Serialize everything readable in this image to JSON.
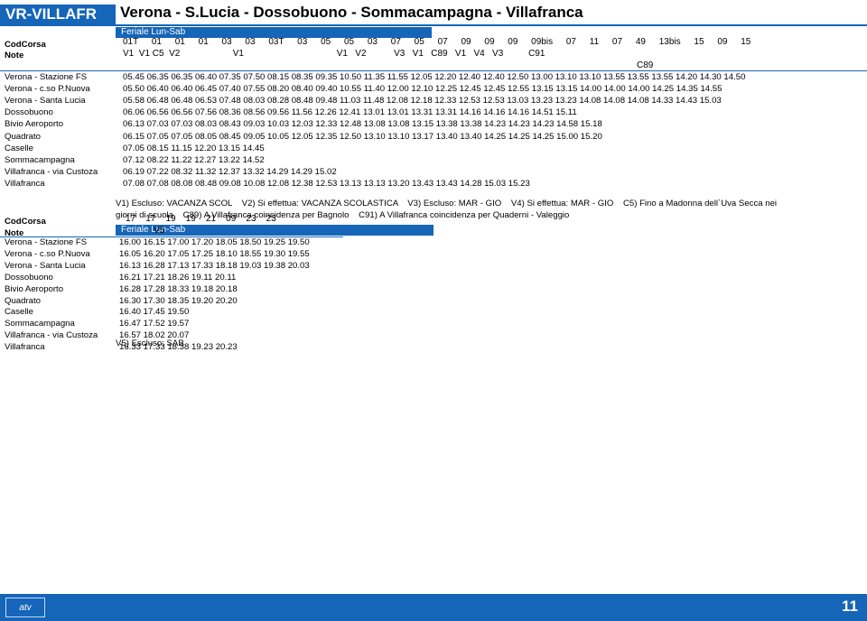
{
  "header": {
    "tag": "VR-VILLAFR",
    "title": "Verona - S.Lucia - Dossobuono - Sommacampagna - Villafranca"
  },
  "table1": {
    "band_label": "Feriale Lun-Sab",
    "codcorsa_label": "CodCorsa",
    "codcorsa": "01T 01 01 01 03 03 03T 03 05 05 03 07 05 07 09 09 09 09bis 07 11 07 49 13bis 15 09 15",
    "note_label": "Note",
    "note": "V1  V1 C5  V2                     V1                                     V1   V2           V3   V1   C89   V1   V4   V3          C91",
    "note2": "C89",
    "rows": [
      {
        "label": "Verona - Stazione FS",
        "times": "05.45 06.35 06.35 06.40 07.35 07.50 08.15 08.35 09.35 10.50 11.35 11.55 12.05 12.20 12.40 12.40 12.50 13.00 13.10 13.10 13.55 13.55 13.55 14.20 14.30 14.50"
      },
      {
        "label": "Verona - c.so P.Nuova",
        "times": "05.50 06.40 06.40 06.45 07.40 07.55 08.20 08.40 09.40 10.55 11.40 12.00 12.10 12.25 12.45 12.45 12.55 13.15 13.15 14.00 14.00 14.00 14.25 14.35 14.55"
      },
      {
        "label": "Verona - Santa Lucia",
        "times": "05.58 06.48 06.48 06.53 07.48 08.03 08.28 08.48 09.48 11.03 11.48 12.08 12.18 12.33 12.53 12.53 13.03 13.23 13.23 14.08 14.08 14.08 14.33 14.43 15.03"
      },
      {
        "label": "Dossobuono",
        "times": "06.06 06.56 06.56 07.56 08.36 08.56 09.56 11.56 12.26 12.41 13.01 13.01 13.31 13.31 14.16 14.16 14.16 14.51 15.11"
      },
      {
        "label": "Bivio Aeroporto",
        "times": "06.13 07.03 07.03 08.03 08.43 09.03 10.03 12.03 12.33 12.48 13.08 13.08 13.15 13.38 13.38 14.23 14.23 14.23 14.58 15.18"
      },
      {
        "label": "Quadrato",
        "times": "06.15 07.05 07.05 08.05 08.45 09.05 10.05 12.05 12.35 12.50 13.10 13.10 13.17 13.40 13.40 14.25 14.25 14.25 15.00 15.20"
      },
      {
        "label": "Caselle",
        "times": "07.05 08.15 11.15 12.20 13.15 14.45"
      },
      {
        "label": "Sommacampagna",
        "times": "07.12 08.22 11.22 12.27 13.22 14.52"
      },
      {
        "label": "Villafranca - via Custoza",
        "times": "06.19 07.22 08.32 11.32 12.37 13.32 14.29 14.29 15.02"
      },
      {
        "label": "Villafranca",
        "times": "07.08 07.08 08.08 08.48 09.08 10.08 12.08 12.38 12.53 13.13 13.13 13.20 13.43 13.43 14.28 15.03 15.23"
      }
    ],
    "notes_line1": "V1) Escluso: VACANZA SCOL    V2) Si effettua: VACANZA SCOLASTICA    V3) Escluso: MAR - GIO    V4) Si effettua: MAR - GIO    C5) Fino a Madonna dell`Uva Secca nei",
    "notes_line2": "giorni di scuola    C89) A Villafranca coincidenza per Bagnolo    C91) A Villafranca coincidenza per Quaderni - Valeggio"
  },
  "table2": {
    "band_label": "Feriale Lun-Sab",
    "codcorsa_label": "CodCorsa",
    "codcorsa": "17    17    19    19    21    09    23    23",
    "note_label": "Note",
    "note": "V5",
    "rows": [
      {
        "label": "Verona - Stazione FS",
        "times": "16.00 16.15 17.00 17.20 18.05 18.50 19.25 19.50"
      },
      {
        "label": "Verona - c.so P.Nuova",
        "times": "16.05 16.20 17.05 17.25 18.10 18.55 19.30 19.55"
      },
      {
        "label": "Verona - Santa Lucia",
        "times": "16.13 16.28 17.13 17.33 18.18 19.03 19.38 20.03"
      },
      {
        "label": "Dossobuono",
        "times": "16.21 17.21 18.26 19.11 20.11"
      },
      {
        "label": "Bivio Aeroporto",
        "times": "16.28 17.28 18.33 19.18 20.18"
      },
      {
        "label": "Quadrato",
        "times": "16.30 17.30 18.35 19.20 20.20"
      },
      {
        "label": "Caselle",
        "times": "16.40 17.45 19.50"
      },
      {
        "label": "Sommacampagna",
        "times": "16.47 17.52 19.57"
      },
      {
        "label": "Villafranca - via Custoza",
        "times": "16.57 18.02 20.07"
      },
      {
        "label": "Villafranca",
        "times": "16.33 17.33 18.38 19.23 20.23"
      }
    ],
    "notes_line1": "V5) Escluso: SAB"
  },
  "footer": {
    "logo": "atv",
    "page": "11"
  }
}
